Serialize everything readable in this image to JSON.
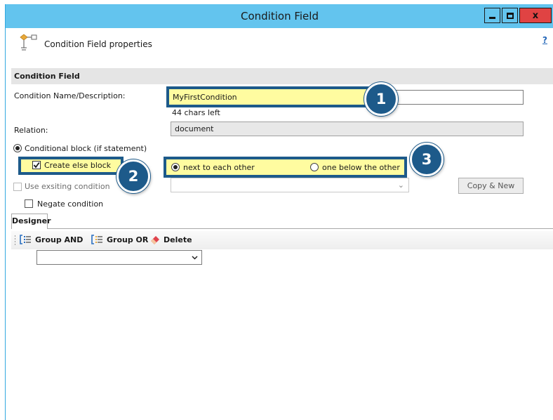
{
  "window": {
    "title": "Condition Field",
    "minimize_symbol": "▁",
    "close_symbol": "x"
  },
  "header": {
    "title": "Condition Field properties",
    "help": "?",
    "icon": "condition-field-icon"
  },
  "section": {
    "title": "Condition Field"
  },
  "form": {
    "name_label": "Condition Name/Description:",
    "name_value": "MyFirstCondition",
    "chars_left": "44 chars left",
    "relation_label": "Relation:",
    "relation_value": "document",
    "conditional_block_label": "Conditional block (if statement)",
    "create_else_label": "Create else block",
    "create_else_checked": true,
    "layout_options": [
      {
        "label": "next to each other",
        "checked": true
      },
      {
        "label": "one below the other",
        "checked": false
      }
    ],
    "use_existing_label": "Use exsiting condition",
    "use_existing_value": "",
    "copy_new_label": "Copy & New",
    "negate_label": "Negate condition"
  },
  "tabs": {
    "designer": "Designer"
  },
  "toolbar": {
    "group_and": "Group AND",
    "group_or": "Group OR",
    "delete": "Delete"
  },
  "designer": {
    "combo_value": ""
  },
  "callouts": [
    "1",
    "2",
    "3"
  ],
  "colors": {
    "titlebar": "#63c4ee",
    "callout_border": "#1d5a8a",
    "highlight": "#fff99a",
    "close_button": "#e04343"
  }
}
